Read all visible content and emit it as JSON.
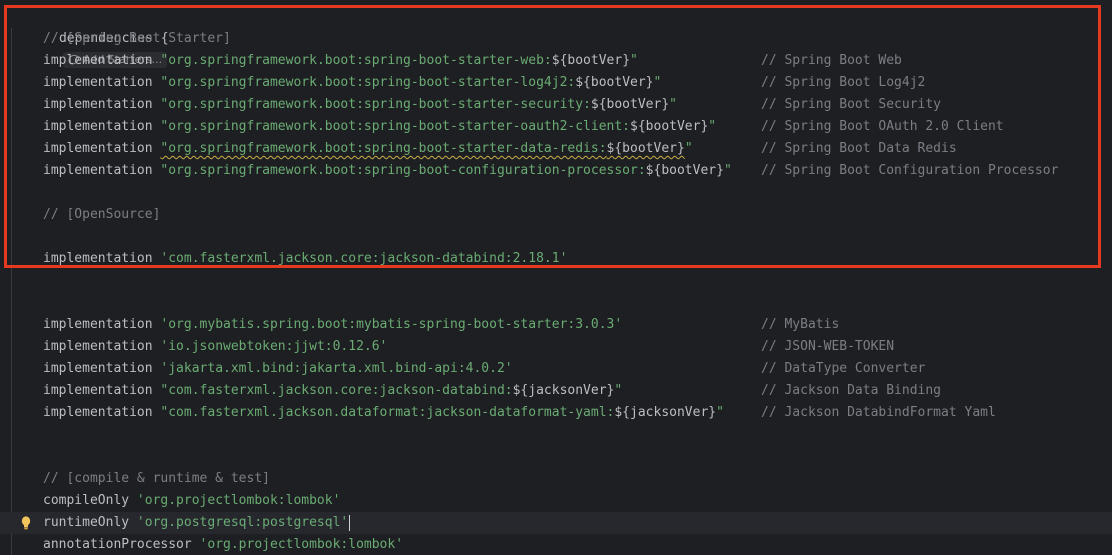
{
  "header": {
    "keyword": "dependencies",
    "brace": " {",
    "hint_label": "Add Starters..."
  },
  "starter_block": {
    "comment": "// [Spring Boot Starter]",
    "lines": [
      {
        "config": "implementation",
        "pre": "\"org.springframework.boot:spring-boot-starter-web:",
        "var": "${bootVer}",
        "post": "\"",
        "comment": "// Spring Boot Web"
      },
      {
        "config": "implementation",
        "pre": "\"org.springframework.boot:spring-boot-starter-log4j2:",
        "var": "${bootVer}",
        "post": "\"",
        "comment": "// Spring Boot Log4j2"
      },
      {
        "config": "implementation",
        "pre": "\"org.springframework.boot:spring-boot-starter-security:",
        "var": "${bootVer}",
        "post": "\"",
        "comment": "// Spring Boot Security"
      },
      {
        "config": "implementation",
        "pre": "\"org.springframework.boot:spring-boot-starter-oauth2-client:",
        "var": "${bootVer}",
        "post": "\"",
        "comment": "// Spring Boot OAuth 2.0 Client"
      },
      {
        "config": "implementation",
        "pre": "\"org.springframework.boot:spring-boot-starter-data-redis:",
        "var": "${bootVer}",
        "post": "\"",
        "comment": "// Spring Boot Data Redis"
      },
      {
        "config": "implementation",
        "pre": "\"org.springframework.boot:spring-boot-configuration-processor:",
        "var": "${bootVer}",
        "post": "\"",
        "comment": "// Spring Boot Configuration Processor"
      }
    ]
  },
  "opensource_block": {
    "comment": "// [OpenSource]",
    "line": {
      "config": "implementation",
      "str": "'com.fasterxml.jackson.core:jackson-databind:2.18.1'"
    }
  },
  "library_block": {
    "lines": [
      {
        "config": "implementation",
        "pre": "'org.mybatis.spring.boot:mybatis-spring-boot-starter:3.0.3'",
        "var": "",
        "post": "",
        "comment": "// MyBatis"
      },
      {
        "config": "implementation",
        "pre": "'io.jsonwebtoken:jjwt:0.12.6'",
        "var": "",
        "post": "",
        "comment": "// JSON-WEB-TOKEN"
      },
      {
        "config": "implementation",
        "pre": "'jakarta.xml.bind:jakarta.xml.bind-api:4.0.2'",
        "var": "",
        "post": "",
        "comment": "// DataType Converter"
      },
      {
        "config": "implementation",
        "pre": "\"com.fasterxml.jackson.core:jackson-databind:",
        "var": "${jacksonVer}",
        "post": "\"",
        "comment": "// Jackson Data Binding"
      },
      {
        "config": "implementation",
        "pre": "\"com.fasterxml.jackson.dataformat:jackson-dataformat-yaml:",
        "var": "${jacksonVer}",
        "post": "\"",
        "comment": "// Jackson DatabindFormat Yaml"
      }
    ]
  },
  "runtime_block": {
    "comment": "// [compile & runtime & test]",
    "lines": [
      {
        "config": "compileOnly",
        "str": "'org.projectlombok:lombok'"
      },
      {
        "config": "runtimeOnly",
        "str": "'org.postgresql:postgresql'"
      },
      {
        "config": "annotationProcessor",
        "str": "'org.projectlombok:lombok'"
      }
    ]
  },
  "colors": {
    "background": "#1e1f22",
    "string": "#6aab73",
    "comment": "#7a7e85",
    "highlight_border": "#e53a1f",
    "warning_underline": "#c8b045"
  }
}
